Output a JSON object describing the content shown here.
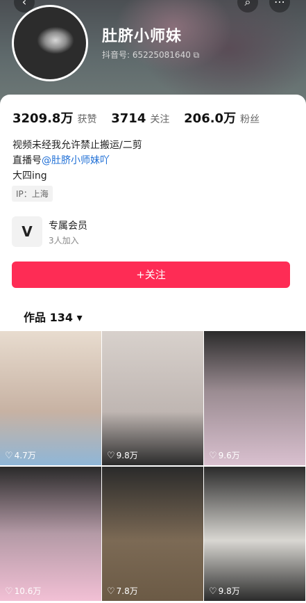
{
  "profile": {
    "name": "肚脐小师妹",
    "uid_label": "抖音号: 65225081640 ⧉"
  },
  "stats": {
    "likes_value": "3209.8万",
    "likes_label": "获赞",
    "following_value": "3714",
    "following_label": "关注",
    "followers_value": "206.0万",
    "followers_label": "粉丝"
  },
  "bio": {
    "line1": "视频未经我允许禁止搬运/二剪",
    "line2_prefix": "直播号",
    "line2_link": "@肚脐小师妹吖",
    "line3": "大四ing",
    "ip": "IP：上海"
  },
  "membership": {
    "title": "专属会员",
    "subtitle": "3人加入"
  },
  "follow_button": "+关注",
  "works_tab": "作品 134",
  "works_chevron": "▾",
  "videos": [
    {
      "likes": "4.7万",
      "color": "#d9c7b8"
    },
    {
      "likes": "9.8万",
      "color": "#c9c2bf"
    },
    {
      "likes": "9.6万",
      "color": "#8f8f8f"
    },
    {
      "likes": "10.6万",
      "color": "#6f6b68"
    },
    {
      "likes": "7.8万",
      "color": "#7a746b"
    },
    {
      "likes": "9.8万",
      "color": "#9b9791"
    }
  ]
}
